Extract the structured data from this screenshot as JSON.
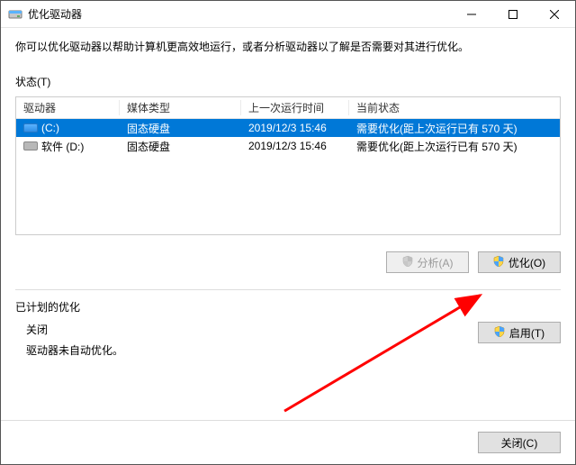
{
  "titlebar": {
    "title": "优化驱动器"
  },
  "description": "你可以优化驱动器以帮助计算机更高效地运行，或者分析驱动器以了解是否需要对其进行优化。",
  "status_label": "状态(T)",
  "columns": {
    "drive": "驱动器",
    "media": "媒体类型",
    "last_run": "上一次运行时间",
    "status": "当前状态"
  },
  "drives": [
    {
      "name": "(C:)",
      "media": "固态硬盘",
      "last_run": "2019/12/3 15:46",
      "status": "需要优化(距上次运行已有 570 天)",
      "selected": true,
      "icon": "local"
    },
    {
      "name": "软件 (D:)",
      "media": "固态硬盘",
      "last_run": "2019/12/3 15:46",
      "status": "需要优化(距上次运行已有 570 天)",
      "selected": false,
      "icon": "hdd"
    }
  ],
  "buttons": {
    "analyze": "分析(A)",
    "optimize": "优化(O)",
    "enable": "启用(T)",
    "close": "关闭(C)"
  },
  "schedule": {
    "header": "已计划的优化",
    "off": "关闭",
    "note": "驱动器未自动优化。"
  }
}
